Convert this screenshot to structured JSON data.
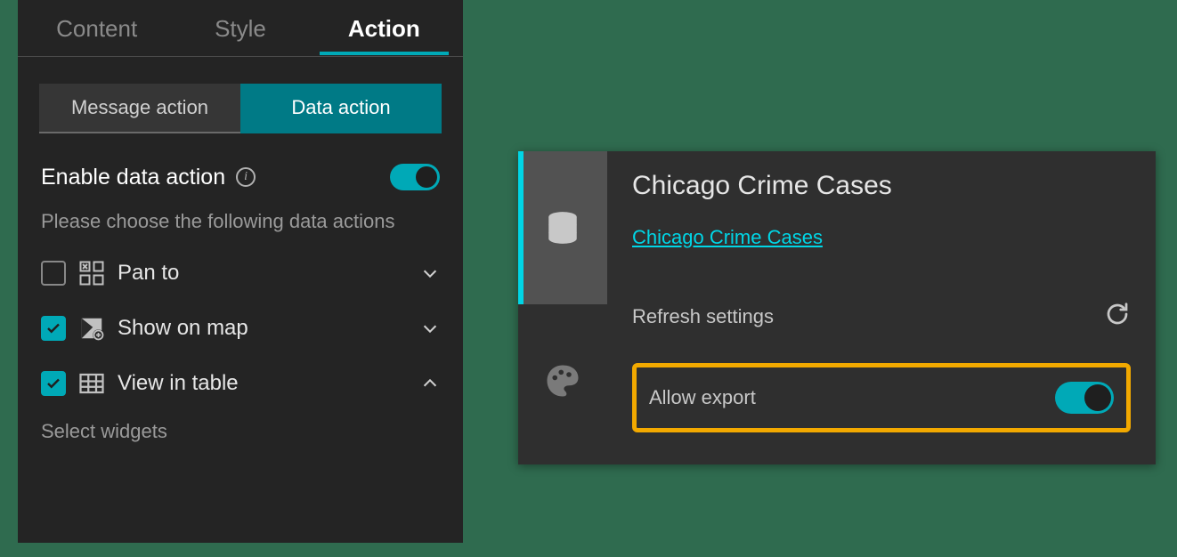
{
  "leftPanel": {
    "tabs": [
      {
        "label": "Content",
        "active": false
      },
      {
        "label": "Style",
        "active": false
      },
      {
        "label": "Action",
        "active": true
      }
    ],
    "subTabs": [
      {
        "label": "Message action",
        "active": false
      },
      {
        "label": "Data action",
        "active": true
      }
    ],
    "enableLabel": "Enable data action",
    "enableToggle": true,
    "helper": "Please choose the following data actions",
    "actions": [
      {
        "label": "Pan to",
        "checked": false,
        "expanded": false,
        "icon": "pan"
      },
      {
        "label": "Show on map",
        "checked": true,
        "expanded": false,
        "icon": "map"
      },
      {
        "label": "View in table",
        "checked": true,
        "expanded": true,
        "icon": "table"
      }
    ],
    "selectWidgets": "Select widgets"
  },
  "rightPanel": {
    "title": "Chicago Crime Cases",
    "link": "Chicago Crime Cases",
    "refreshLabel": "Refresh settings",
    "allowExportLabel": "Allow export",
    "allowExportToggle": true,
    "sideRail": [
      {
        "name": "data",
        "active": true
      },
      {
        "name": "style",
        "active": false
      }
    ]
  },
  "colors": {
    "accent": "#00a9b7",
    "highlight": "#f2a900"
  }
}
